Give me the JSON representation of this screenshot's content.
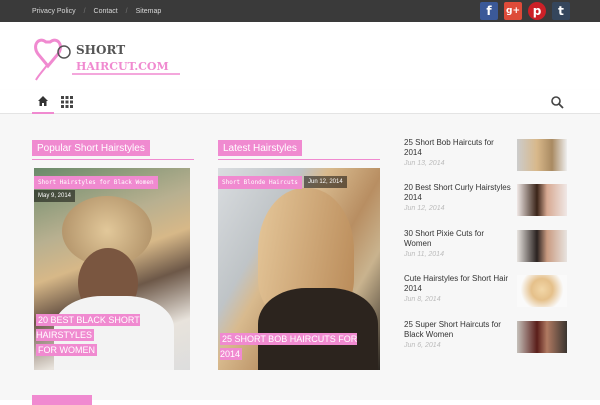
{
  "topbar": {
    "links": [
      "Privacy Policy",
      "Contact",
      "Sitemap"
    ],
    "social": [
      {
        "name": "facebook",
        "glyph": "f",
        "color": "#3b5998"
      },
      {
        "name": "google-plus",
        "glyph": "g+",
        "color": "#dd4b39"
      },
      {
        "name": "pinterest",
        "glyph": "p",
        "color": "#cb2027"
      },
      {
        "name": "tumblr",
        "glyph": "t",
        "color": "#35465c"
      }
    ]
  },
  "logo": {
    "line1": "SHORT",
    "line2": "HAIRCUT.COM"
  },
  "nav": {
    "home_icon": "home-icon",
    "grid_icon": "grid-icon",
    "search_icon": "search-icon"
  },
  "sections": {
    "popular": "Popular Short Hairstyles",
    "latest": "Latest Hairstyles"
  },
  "cards": [
    {
      "category": "Short Hairstyles for Black Women",
      "date": "May 9, 2014",
      "title_line1": "20 BEST BLACK SHORT HAIRSTYLES",
      "title_line2": "FOR WOMEN"
    },
    {
      "category": "Short Blonde Haircuts",
      "date": "Jun 12, 2014",
      "title_line1": "25 SHORT BOB HAIRCUTS FOR 2014"
    }
  ],
  "list": [
    {
      "title": "25 Short Bob Haircuts for 2014",
      "date": "Jun 13, 2014"
    },
    {
      "title": "20 Best Short Curly Hairstyles 2014",
      "date": "Jun 12, 2014"
    },
    {
      "title": "30 Short Pixie Cuts for Women",
      "date": "Jun 11, 2014"
    },
    {
      "title": "Cute Hairstyles for Short Hair 2014",
      "date": "Jun 8, 2014"
    },
    {
      "title": "25 Super Short Haircuts for Black Women",
      "date": "Jun 6, 2014"
    }
  ],
  "colors": {
    "accent": "#f08ad0",
    "topbar": "#3a3a3a"
  }
}
